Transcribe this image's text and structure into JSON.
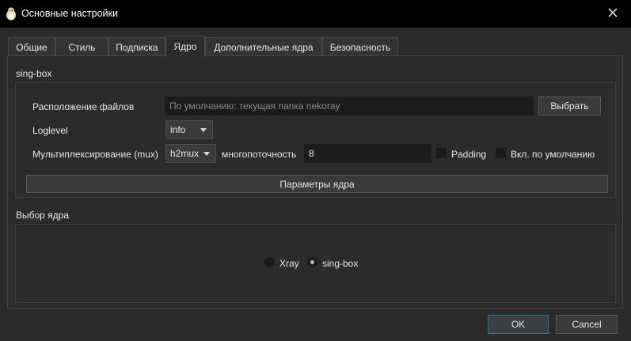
{
  "window": {
    "title": "Основные настройки",
    "close_icon": "close-icon",
    "app_icon": "penguin-icon"
  },
  "tabs": [
    {
      "label": "Общие",
      "active": false
    },
    {
      "label": "Стиль",
      "active": false
    },
    {
      "label": "Подписка",
      "active": false
    },
    {
      "label": "Ядро",
      "active": true
    },
    {
      "label": "Дополнительные ядра",
      "active": false
    },
    {
      "label": "Безопасность",
      "active": false
    }
  ],
  "singbox": {
    "group_title": "sing-box",
    "files_location_label": "Расположение файлов",
    "files_location_value": "",
    "files_location_placeholder": "По умолчанию: текущая папка nekoray",
    "browse_button": "Выбрать",
    "loglevel_label": "Loglevel",
    "loglevel_value": "info",
    "mux_label": "Мультиплексирование (mux)",
    "mux_value": "h2mux",
    "concurrency_label": "многопоточность",
    "concurrency_value": "8",
    "padding_label": "Padding",
    "padding_checked": false,
    "default_on_label": "Вкл. по умолчанию",
    "default_on_checked": false,
    "core_params_button": "Параметры ядра"
  },
  "core_select": {
    "group_title": "Выбор ядра",
    "options": [
      {
        "label": "Xray",
        "checked": false
      },
      {
        "label": "sing-box",
        "checked": true
      }
    ]
  },
  "footer": {
    "ok_label": "OK",
    "cancel_label": "Cancel"
  },
  "colors": {
    "titlebar": "#000000",
    "background": "#2b2b2b",
    "input_bg": "#1c1c1c",
    "ok_border": "#4a6a8a"
  }
}
